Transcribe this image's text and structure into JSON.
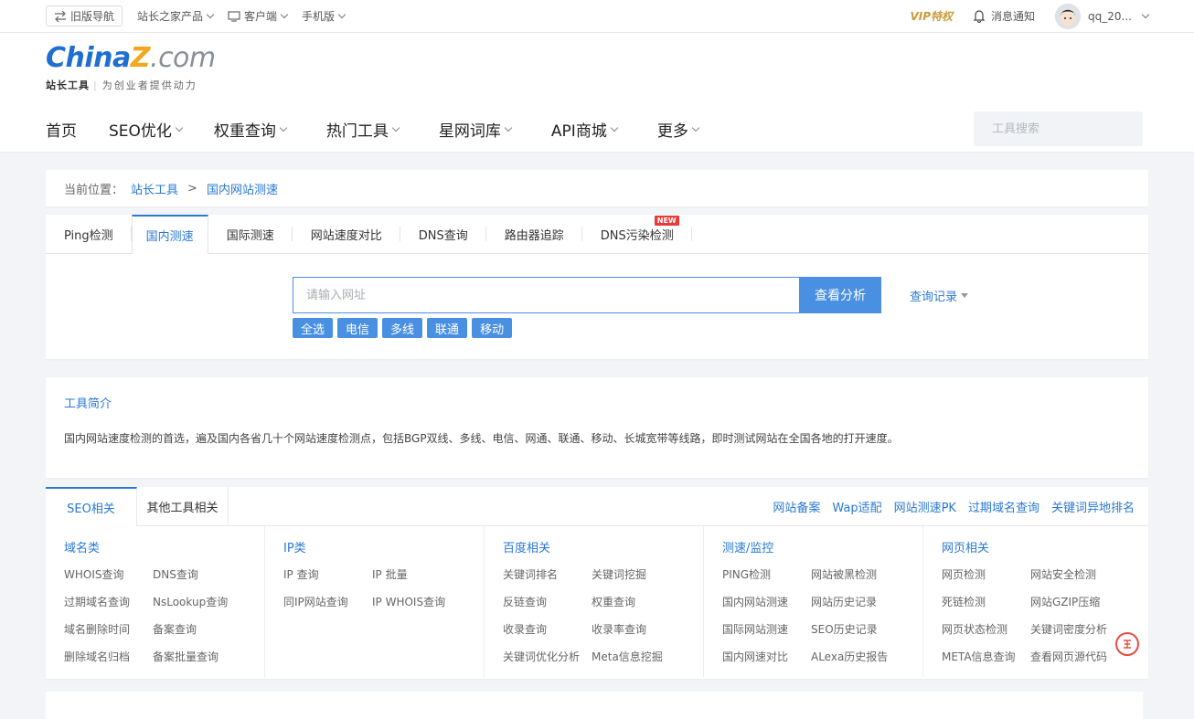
{
  "topbar": {
    "old_nav": "旧版导航",
    "products": "站长之家产品",
    "client": "客户端",
    "mobile": "手机版",
    "vip": "VIP特权",
    "notify": "消息通知",
    "user": "qq_20..."
  },
  "logo": {
    "china": "China",
    "z": "Z",
    "com": ".com",
    "brand": "站长工具",
    "slogan": "为创业者提供动力"
  },
  "nav": [
    "首页",
    "SEO优化",
    "权重查询",
    "热门工具",
    "星网词库",
    "API商城",
    "更多"
  ],
  "search": {
    "placeholder": "工具搜索"
  },
  "breadcrumb": {
    "label": "当前位置：",
    "item1": "站长工具",
    "sep": ">",
    "item2": "国内网站测速"
  },
  "tool_tabs": [
    "Ping检测",
    "国内测速",
    "国际测速",
    "网站速度对比",
    "DNS查询",
    "路由器追踪",
    "DNS污染检测"
  ],
  "tool_tabs_new_badge": "NEW",
  "query": {
    "placeholder": "请输入网址",
    "button": "查看分析",
    "history": "查询记录",
    "filters": [
      "全选",
      "电信",
      "多线",
      "联通",
      "移动"
    ]
  },
  "intro": {
    "title": "工具简介",
    "text": "国内网站速度检测的首选，遍及国内各省几十个网站速度检测点，包括BGP双线、多线、电信、网通、联通、移动、长城宽带等线路，即时测试网站在全国各地的打开速度。"
  },
  "related": {
    "tabs": [
      "SEO相关",
      "其他工具相关"
    ],
    "quick_links": [
      "网站备案",
      "Wap适配",
      "网站测速PK",
      "过期域名查询",
      "关键词异地排名"
    ],
    "columns": [
      {
        "title": "域名类",
        "links": [
          "WHOIS查询",
          "DNS查询",
          "过期域名查询",
          "NsLookup查询",
          "域名删除时间",
          "备案查询",
          "删除域名归档",
          "备案批量查询"
        ]
      },
      {
        "title": "IP类",
        "links": [
          "IP 查询",
          "IP 批量",
          "同IP网站查询",
          "IP WHOIS查询"
        ]
      },
      {
        "title": "百度相关",
        "links": [
          "关键词排名",
          "关键词挖掘",
          "反链查询",
          "权重查询",
          "收录查询",
          "收录率查询",
          "关键词优化分析",
          "Meta信息挖掘"
        ]
      },
      {
        "title": "测速/监控",
        "links": [
          "PING检测",
          "网站被黑检测",
          "国内网站测速",
          "网站历史记录",
          "国际网站测速",
          "SEO历史记录",
          "国内网速对比",
          "ALexa历史报告"
        ]
      },
      {
        "title": "网页相关",
        "links": [
          "网页检测",
          "网站安全检测",
          "死链检测",
          "网站GZIP压缩",
          "网页状态检测",
          "关键词密度分析",
          "META信息查询",
          "查看网页源代码"
        ]
      }
    ]
  },
  "colors": {
    "accent": "#4a90e2",
    "link": "#2a79d6",
    "badge": "#e83b3b"
  }
}
